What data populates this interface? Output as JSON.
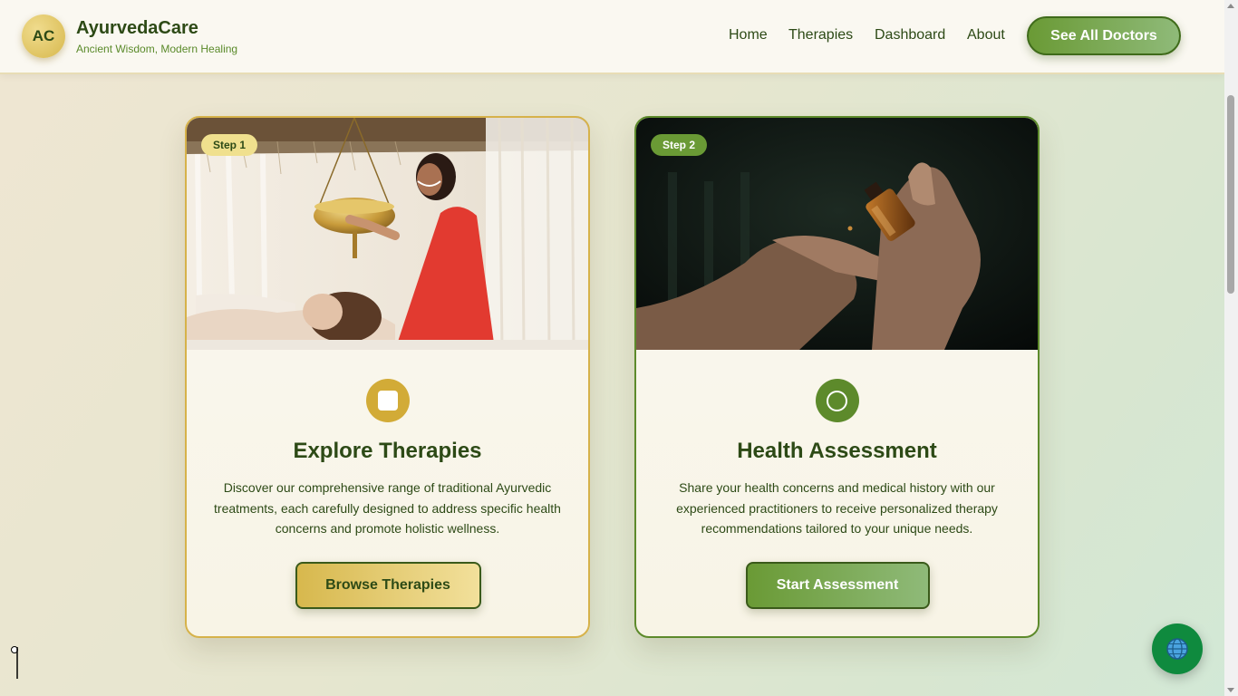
{
  "header": {
    "logo_initials": "AC",
    "brand_name": "AyurvedaCare",
    "tagline": "Ancient Wisdom, Modern Healing",
    "nav": {
      "home": "Home",
      "therapies": "Therapies",
      "dashboard": "Dashboard",
      "about": "About"
    },
    "cta_label": "See All Doctors"
  },
  "cards": [
    {
      "step": "Step 1",
      "icon": "square-icon",
      "title": "Explore Therapies",
      "description": "Discover our comprehensive range of traditional Ayurvedic treatments, each carefully designed to address specific health concerns and promote holistic wellness.",
      "button": "Browse Therapies",
      "image": "shirodhara-therapy-photo"
    },
    {
      "step": "Step 2",
      "icon": "circle-icon",
      "title": "Health Assessment",
      "description": "Share your health concerns and medical history with our experienced practitioners to receive personalized therapy recommendations tailored to your unique needs.",
      "button": "Start Assessment",
      "image": "oil-dropper-hand-photo"
    }
  ],
  "floating_button": {
    "icon": "globe-icon"
  },
  "colors": {
    "primary_green": "#5d8a2b",
    "gold": "#d6b24a",
    "dark_text": "#2d4a16"
  }
}
